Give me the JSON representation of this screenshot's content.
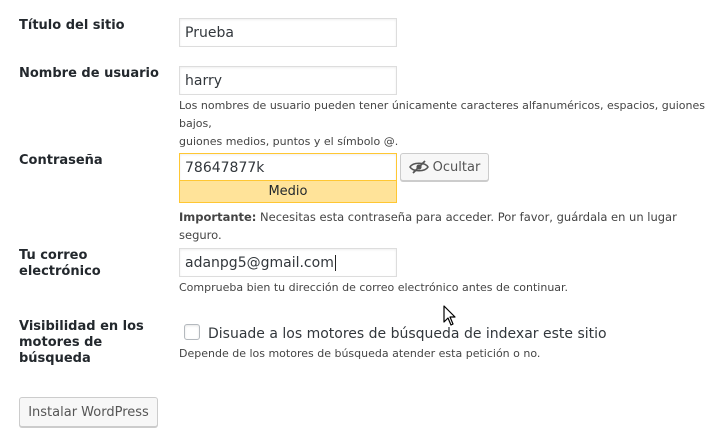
{
  "site_title": {
    "label": "Título del sitio",
    "value": "Prueba"
  },
  "username": {
    "label": "Nombre de usuario",
    "value": "harry",
    "help_line1": "Los nombres de usuario pueden tener únicamente caracteres alfanuméricos, espacios, guiones bajos,",
    "help_line2": "guiones medios, puntos y el símbolo @."
  },
  "password": {
    "label": "Contraseña",
    "value": "78647877k",
    "strength": "Medio",
    "toggle_label": "Ocultar",
    "note_strong": "Importante:",
    "note_text": " Necesitas esta contraseña para acceder. Por favor, guárdala en un lugar seguro."
  },
  "email": {
    "label_line1": "Tu correo",
    "label_line2": "electrónico",
    "value": "adanpg5@gmail.com",
    "help": "Comprueba bien tu dirección de correo electrónico antes de continuar."
  },
  "visibility": {
    "label_line1": "Visibilidad en los",
    "label_line2": "motores de",
    "label_line3": "búsqueda",
    "checkbox_label": "Disuade a los motores de búsqueda de indexar este sitio",
    "checked": false,
    "help": "Depende de los motores de búsqueda atender esta petición o no."
  },
  "submit_label": "Instalar WordPress",
  "colors": {
    "strength_bg": "#ffe399",
    "strength_border": "#ffc733"
  },
  "icons": {
    "toggle": "eye-slash-icon",
    "pointer": "mouse-cursor-icon"
  }
}
